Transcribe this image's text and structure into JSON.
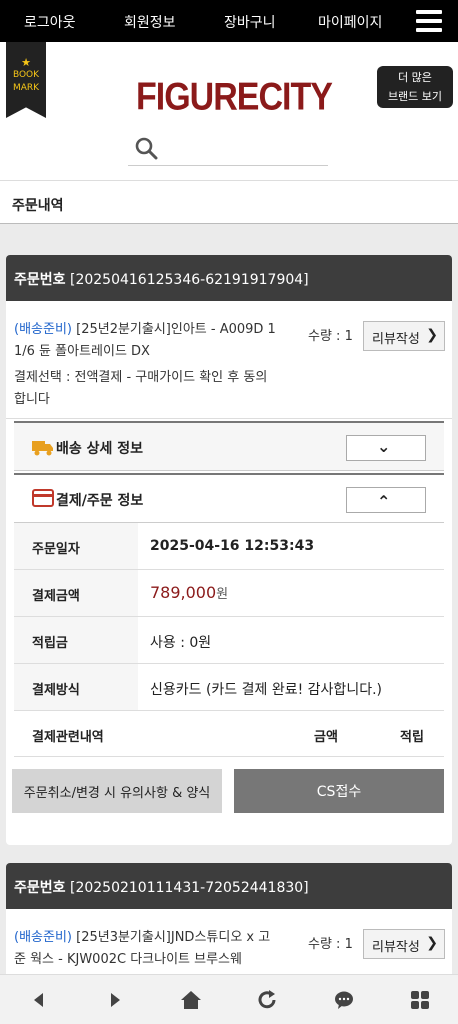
{
  "topnav": {
    "logout": "로그아웃",
    "member_info": "회원정보",
    "cart": "장바구니",
    "mypage": "마이페이지"
  },
  "header": {
    "bookmark_line1": "BOOK",
    "bookmark_line2": "MARK",
    "logo": "FIGURECITY",
    "brand_btn_line1": "더 많은",
    "brand_btn_line2": "브랜드 보기"
  },
  "breadcrumb": "주문내역",
  "orders": [
    {
      "no_label": "주문번호",
      "no": "[20250416125346-62191917904]",
      "status": "(배송준비)",
      "title": " [25년2분기출시]인아트 - A009D 1 1/6 듄 폴아트레이드 DX",
      "option": "결제선택 : 전액결제 - 구매가이드 확인 후 동의합니다",
      "qty": "수량 : 1",
      "review": "리뷰작성",
      "delivery_section": "배송 상세 정보",
      "payment_section": "결제/주문 정보",
      "rows": [
        {
          "k": "주문일자",
          "v": "2025-04-16 12:53:43"
        },
        {
          "k": "결제금액",
          "v": "789,000",
          "unit": "원"
        },
        {
          "k": "적립금",
          "v": "사용 : 0원"
        },
        {
          "k": "결제방식",
          "v": "신용카드 (카드 결제 완료! 감사합니다.)"
        }
      ],
      "history_header": {
        "c1": "결제관련내역",
        "c2": "금액",
        "c3": "적립"
      },
      "cancel_btn": "주문취소/변경 시 유의사항 & 양식",
      "cs_btn": "CS접수"
    },
    {
      "no_label": "주문번호",
      "no": "[20250210111431-72052441830]",
      "status": "(배송준비)",
      "title": " [25년3분기출시]JND스튜디오 x 고준 웍스 - KJW002C 다크나이트 브루스웨",
      "qty": "수량 : 1",
      "review": "리뷰작성"
    }
  ],
  "colors": {
    "accent": "#8b1a1a",
    "status": "#2266cc",
    "header_bg": "#3d3d3d"
  }
}
